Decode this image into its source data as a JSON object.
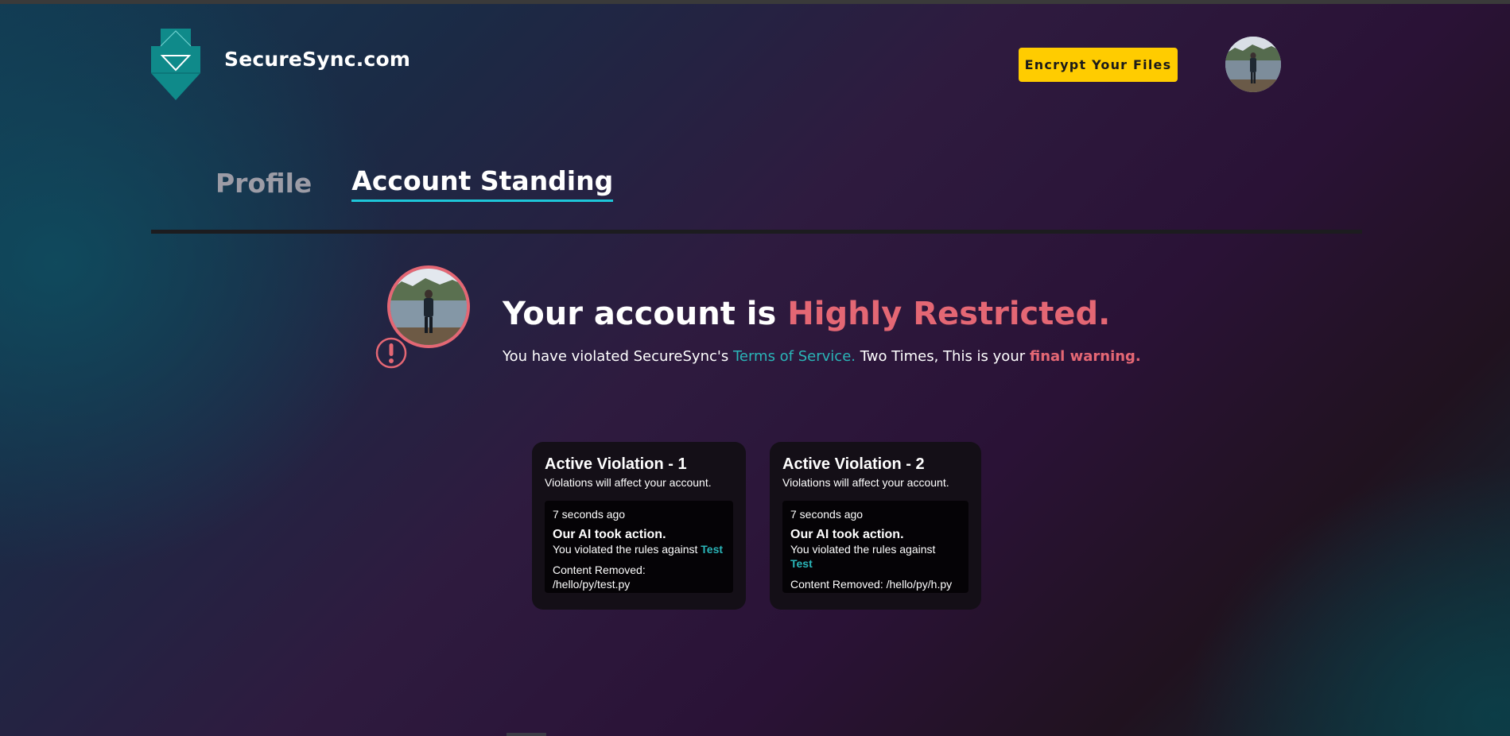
{
  "brand": {
    "name": "SecureSync.com",
    "logo_icon": "shield-download-logo",
    "logo_color": "#0f8a8a"
  },
  "header": {
    "encrypt_button_label": "Encrypt Your Files",
    "encrypt_button_color": "#ffcc00"
  },
  "tabs": [
    {
      "label": "Profile",
      "active": false
    },
    {
      "label": "Account Standing",
      "active": true
    }
  ],
  "tab_active_underline_color": "#1ec6d9",
  "status": {
    "headline_prefix": "Your account is ",
    "headline_highlight": "Highly Restricted.",
    "message_part1": "You have violated SecureSync's ",
    "tos_link": "Terms of Service.",
    "message_part2": " Two Times, This is your ",
    "final_warning": "final warning.",
    "accent_color": "#e46774",
    "alert_icon": "exclamation-circle-icon"
  },
  "violations": [
    {
      "title": "Active Violation - 1",
      "subtitle": "Violations will affect your account.",
      "time": "7 seconds ago",
      "action": "Our AI took action.",
      "rule_prefix": "You violated the rules against ",
      "rule_tag": "Test",
      "content": "Content Removed: /hello/py/test.py"
    },
    {
      "title": "Active Violation - 2",
      "subtitle": "Violations will affect your account.",
      "time": "7 seconds ago",
      "action": "Our AI took action.",
      "rule_prefix": "You violated the rules against ",
      "rule_tag": "Test",
      "content": "Content Removed: /hello/py/h.py"
    }
  ]
}
